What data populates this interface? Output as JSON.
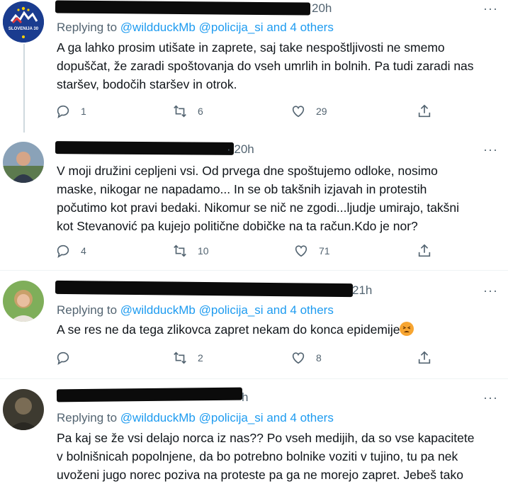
{
  "tweets": [
    {
      "avatar": "slovenia-30-logo",
      "avatar_text": "SLOVENIJA 30",
      "time": "20h",
      "replying_prefix": "Replying to",
      "mention1": "@wildduckMb",
      "mention2": "@policija_si",
      "and_others": "and 4 others",
      "lines": [
        "A ga lahko prosim utišate in zaprete, saj take nespoštljivosti ne smemo",
        "dopuščat, že zaradi spoštovanja do vseh umrlih in bolnih. Pa tudi zaradi nas",
        "staršev, bodočih staršev in otrok."
      ],
      "replies": "1",
      "retweets": "6",
      "likes": "29"
    },
    {
      "avatar": "man-avatar",
      "time": "· 20h",
      "lines": [
        "V moji družini cepljeni vsi. Od prvega dne spoštujemo odloke, nosimo",
        "maske, nikogar ne napadamo... In se ob takšnih izjavah in protestih",
        "počutimo kot pravi bedaki. Nikomur se nič ne zgodi...ljudje umirajo, takšni",
        "kot  Stevanović pa kujejo politične dobičke na ta račun.Kdo je nor?"
      ],
      "replies": "4",
      "retweets": "10",
      "likes": "71"
    },
    {
      "avatar": "woman-avatar",
      "time": "21h",
      "replying_prefix": "Replying to",
      "mention1": "@wildduckMb",
      "mention2": "@policija_si",
      "and_others": "and 4 others",
      "lines": [
        "A se res ne da tega zlikovca zapret nekam do konca epidemije"
      ],
      "emoji": "tired-face-emoji",
      "replies": "",
      "retweets": "2",
      "likes": "8"
    },
    {
      "avatar": "dark-avatar",
      "time": "h",
      "replying_prefix": "Replying to",
      "mention1": "@wildduckMb",
      "mention2": "@policija_si",
      "and_others": "and 4 others",
      "lines": [
        "Pa kaj se že vsi delajo norca iz nas?? Po vseh medijih, da so vse kapacitete",
        "v bolnišnicah popolnjene, da bo potrebno bolnike voziti v tujino, tu pa nek",
        "uvoženi jugo norec poziva na proteste pa ga ne morejo zapret. Jebeš tako"
      ]
    }
  ],
  "more_glyph": "···",
  "colors": {
    "accent": "#1d9bf0",
    "secondary": "#536471",
    "text": "#0f1419",
    "divider": "#eff3f4"
  }
}
